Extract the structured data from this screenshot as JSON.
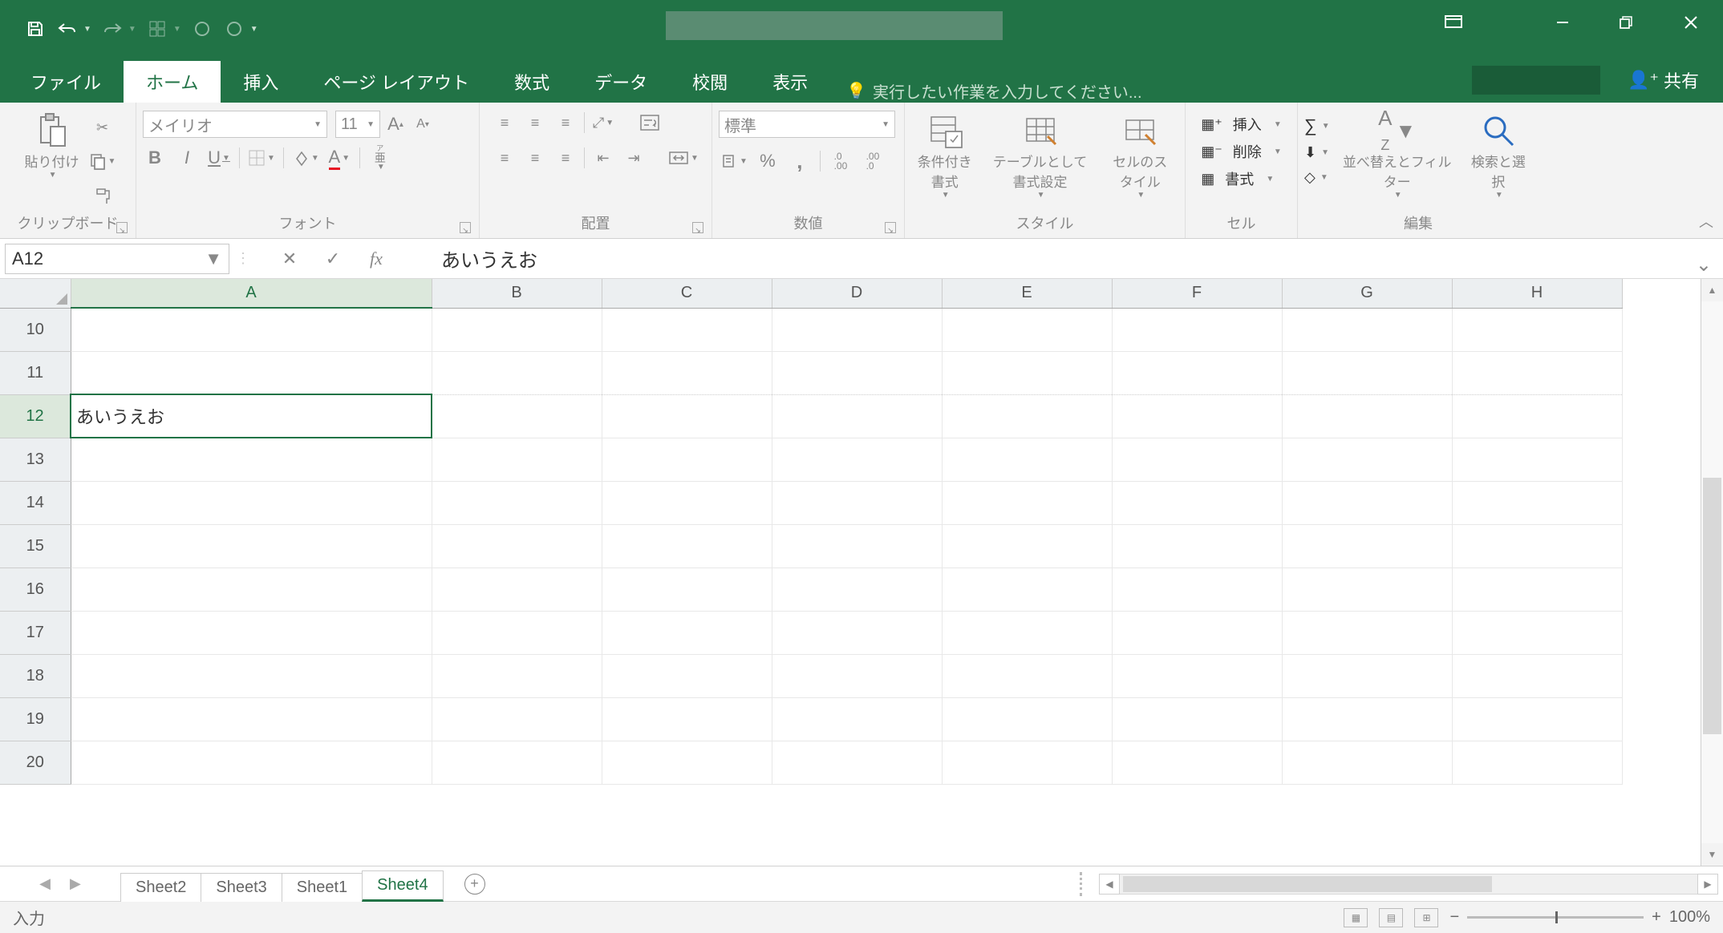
{
  "titlebar": {
    "qat": {
      "save": "save",
      "undo": "undo",
      "redo": "redo"
    }
  },
  "tabs": {
    "file": "ファイル",
    "home": "ホーム",
    "insert": "挿入",
    "page_layout": "ページ レイアウト",
    "formulas": "数式",
    "data": "データ",
    "review": "校閲",
    "view": "表示",
    "tell_me": "実行したい作業を入力してください...",
    "share": "共有"
  },
  "ribbon": {
    "clipboard": {
      "paste": "貼り付け",
      "label": "クリップボード"
    },
    "font": {
      "name": "メイリオ",
      "size": "11",
      "ruby": "ア亜",
      "label": "フォント"
    },
    "alignment": {
      "label": "配置"
    },
    "number": {
      "format": "標準",
      "label": "数値"
    },
    "styles": {
      "cond": "条件付き書式",
      "table": "テーブルとして書式設定",
      "cell": "セルのスタイル",
      "label": "スタイル"
    },
    "cells": {
      "insert": "挿入",
      "delete": "削除",
      "format": "書式",
      "label": "セル"
    },
    "editing": {
      "sort": "並べ替えとフィルター",
      "find": "検索と選択",
      "label": "編集"
    }
  },
  "formula_bar": {
    "name_box": "A12",
    "formula": "あいうえお"
  },
  "grid": {
    "columns": [
      "A",
      "B",
      "C",
      "D",
      "E",
      "F",
      "G",
      "H"
    ],
    "rows": [
      "10",
      "11",
      "12",
      "13",
      "14",
      "15",
      "16",
      "17",
      "18",
      "19",
      "20"
    ],
    "active_cell_value": "あいうえお",
    "active_row": "12",
    "active_col": "A"
  },
  "sheets": {
    "tabs": [
      "Sheet2",
      "Sheet3",
      "Sheet1",
      "Sheet4"
    ],
    "active": "Sheet4"
  },
  "status": {
    "mode": "入力",
    "zoom": "100%"
  }
}
